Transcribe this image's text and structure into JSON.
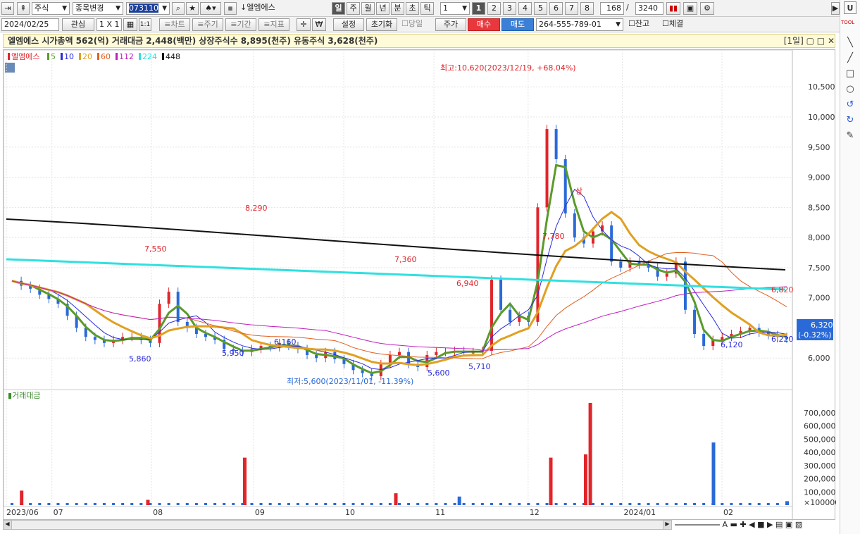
{
  "toolbar": {
    "market": "주식",
    "change_item": "종목변경",
    "stock_code": "073110",
    "stock_name": "엘엠에스",
    "period_tabs": [
      "일",
      "주",
      "월",
      "년",
      "분",
      "초",
      "틱"
    ],
    "period_count": "1",
    "num_tabs": [
      "1",
      "2",
      "3",
      "4",
      "5",
      "6",
      "7",
      "8"
    ],
    "display_count": "168",
    "total_count": "3240",
    "help": "U"
  },
  "toolbar2": {
    "date": "2024/02/25",
    "watch": "관심",
    "layout": "1 X 1",
    "one_to_one": "1:1",
    "chart": "≡차트",
    "price": "≡주기",
    "period": "≡기간",
    "indicator": "≡지표",
    "won": "₩",
    "settings": "설정",
    "reset": "초기화",
    "today": "당일",
    "price_btn": "주가",
    "buy": "매수",
    "sell": "매도",
    "account": "264-555-789-01",
    "balance": "잔고",
    "execution": "체결"
  },
  "info": {
    "text": "엘엠에스  시가총액 562(억)  거래대금 2,448(백만)  상장주식수 8,895(천주)  유동주식 3,628(천주)",
    "period_label": "[1일]"
  },
  "right_tools": {
    "tool_label": "TOOL",
    "icons": [
      "line-icon",
      "diagonal-icon",
      "rectangle-icon",
      "circle-icon",
      "undo-icon",
      "redo-icon",
      "text-icon"
    ]
  },
  "chart_data": [
    {
      "type": "line",
      "title": "엘엠에스",
      "legend": [
        {
          "name": "엘엠에스",
          "color": "#e0252b"
        },
        {
          "name": "5",
          "color": "#5a9a2a"
        },
        {
          "name": "10",
          "color": "#2a2ae0"
        },
        {
          "name": "20",
          "color": "#e0a020"
        },
        {
          "name": "60",
          "color": "#e06020"
        },
        {
          "name": "112",
          "color": "#c020c0"
        },
        {
          "name": "224",
          "color": "#30e0e0"
        },
        {
          "name": "448",
          "color": "#111111"
        }
      ],
      "y_ticks": [
        "10,500",
        "10,000",
        "9,500",
        "9,000",
        "8,500",
        "8,000",
        "7,500",
        "7,000",
        "6,500",
        "6,000"
      ],
      "ylim": [
        5500,
        10900
      ],
      "x_ticks": [
        "2023/06",
        "07",
        "08",
        "09",
        "10",
        "11",
        "12",
        "2024/01",
        "02"
      ],
      "annotations": {
        "high": "최고:10,620(2023/12/19, +68.04%)",
        "low": "최저:5,600(2023/11/01, -11.39%)",
        "upper_limit": "상",
        "labels_top": [
          "7,550",
          "8,290",
          "7,360",
          "6,940",
          "7,780",
          "6,820"
        ],
        "labels_bottom": [
          "5,860",
          "5,950",
          "6,160",
          "5,600",
          "5,710",
          "6,120",
          "6,220"
        ]
      },
      "current_price": "6,320",
      "current_change": "(-0.32%)",
      "close_series": [
        7280,
        7200,
        7150,
        7050,
        6980,
        6900,
        6700,
        6500,
        6350,
        6300,
        6250,
        6300,
        6350,
        6350,
        6300,
        6250,
        6900,
        7100,
        6600,
        6500,
        6400,
        6350,
        6300,
        6150,
        6120,
        6100,
        6150,
        6200,
        6180,
        6250,
        6200,
        6150,
        6050,
        6000,
        6100,
        5980,
        5900,
        5800,
        5750,
        5700,
        5900,
        6050,
        6100,
        5900,
        5850,
        6050,
        6100,
        6100,
        6120,
        6100,
        6100,
        6120,
        7300,
        6800,
        6600,
        6700,
        6600,
        8500,
        9800,
        9300,
        8400,
        8000,
        7900,
        8100,
        8200,
        7600,
        7500,
        7600,
        7550,
        7500,
        7350,
        7400,
        7600,
        6800,
        6400,
        6200,
        6300,
        6350,
        6400,
        6450,
        6500,
        6420,
        6380,
        6350,
        6320
      ]
    },
    {
      "type": "bar",
      "title": "거래대금",
      "y_ticks": [
        "700,000",
        "600,000",
        "500,000",
        "400,000",
        "300,000",
        "200,000",
        "100,000"
      ],
      "unit": "×100000",
      "ylim": [
        0,
        780000
      ],
      "spikes": [
        {
          "pos": 0.012,
          "value": 110000,
          "color": "#e0252b"
        },
        {
          "pos": 0.175,
          "value": 40000,
          "color": "#e0252b"
        },
        {
          "pos": 0.3,
          "value": 360000,
          "color": "#e0252b"
        },
        {
          "pos": 0.495,
          "value": 90000,
          "color": "#e0252b"
        },
        {
          "pos": 0.577,
          "value": 65000,
          "color": "#2a6ad8"
        },
        {
          "pos": 0.695,
          "value": 360000,
          "color": "#e0252b"
        },
        {
          "pos": 0.74,
          "value": 385000,
          "color": "#e0252b"
        },
        {
          "pos": 0.746,
          "value": 775000,
          "color": "#e0252b"
        },
        {
          "pos": 0.905,
          "value": 475000,
          "color": "#2a6ad8"
        },
        {
          "pos": 1.0,
          "value": 30000,
          "color": "#2a6ad8"
        }
      ]
    }
  ]
}
